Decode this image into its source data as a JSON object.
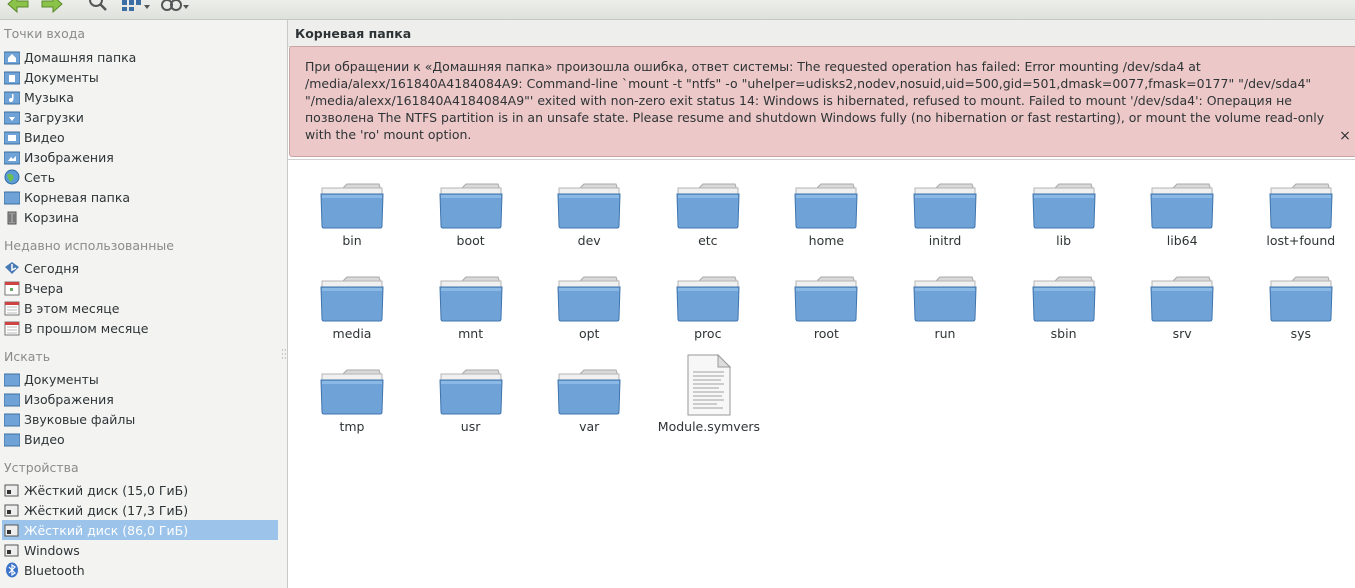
{
  "sidebar": {
    "sections": [
      {
        "title": "Точки входа",
        "items": [
          {
            "label": "Домашняя папка",
            "icon": "home-folder-icon"
          },
          {
            "label": "Документы",
            "icon": "documents-folder-icon"
          },
          {
            "label": "Музыка",
            "icon": "music-folder-icon"
          },
          {
            "label": "Загрузки",
            "icon": "downloads-folder-icon"
          },
          {
            "label": "Видео",
            "icon": "videos-folder-icon"
          },
          {
            "label": "Изображения",
            "icon": "pictures-folder-icon"
          },
          {
            "label": "Сеть",
            "icon": "network-globe-icon"
          },
          {
            "label": "Корневая папка",
            "icon": "root-folder-icon"
          },
          {
            "label": "Корзина",
            "icon": "trash-icon"
          }
        ]
      },
      {
        "title": "Недавно использованные",
        "items": [
          {
            "label": "Сегодня",
            "icon": "recent-today-icon"
          },
          {
            "label": "Вчера",
            "icon": "calendar-icon"
          },
          {
            "label": "В этом месяце",
            "icon": "calendar-icon"
          },
          {
            "label": "В прошлом месяце",
            "icon": "calendar-icon"
          }
        ]
      },
      {
        "title": "Искать",
        "items": [
          {
            "label": "Документы",
            "icon": "documents-folder-icon"
          },
          {
            "label": "Изображения",
            "icon": "pictures-folder-icon"
          },
          {
            "label": "Звуковые файлы",
            "icon": "music-folder-icon"
          },
          {
            "label": "Видео",
            "icon": "videos-folder-icon"
          }
        ]
      },
      {
        "title": "Устройства",
        "items": [
          {
            "label": "Жёсткий диск (15,0 ГиБ)",
            "icon": "hard-disk-icon"
          },
          {
            "label": "Жёсткий диск (17,3 ГиБ)",
            "icon": "hard-disk-icon"
          },
          {
            "label": "Жёсткий диск (86,0 ГиБ)",
            "icon": "hard-disk-icon",
            "selected": true
          },
          {
            "label": "Windows",
            "icon": "hard-disk-icon"
          },
          {
            "label": "Bluetooth",
            "icon": "bluetooth-icon"
          }
        ]
      }
    ]
  },
  "location": {
    "title": "Корневая папка"
  },
  "error": {
    "message": "При обращении к «Домашняя папка» произошла ошибка, ответ системы: The requested operation has failed: Error mounting /dev/sda4 at /media/alexx/161840A4184084A9: Command-line `mount -t \"ntfs\" -o \"uhelper=udisks2,nodev,nosuid,uid=500,gid=501,dmask=0077,fmask=0177\" \"/dev/sda4\" \"/media/alexx/161840A4184084A9\"' exited with non-zero exit status 14: Windows is hibernated, refused to mount. Failed to mount '/dev/sda4': Операция не позволена The NTFS partition is in an unsafe state. Please resume and shutdown Windows fully (no hibernation or fast restarting), or mount the volume read-only with the 'ro' mount option.",
    "close_glyph": "×"
  },
  "files": [
    {
      "name": "bin",
      "type": "folder"
    },
    {
      "name": "boot",
      "type": "folder"
    },
    {
      "name": "dev",
      "type": "folder"
    },
    {
      "name": "etc",
      "type": "folder"
    },
    {
      "name": "home",
      "type": "folder"
    },
    {
      "name": "initrd",
      "type": "folder"
    },
    {
      "name": "lib",
      "type": "folder"
    },
    {
      "name": "lib64",
      "type": "folder"
    },
    {
      "name": "lost+found",
      "type": "folder"
    },
    {
      "name": "media",
      "type": "folder"
    },
    {
      "name": "mnt",
      "type": "folder"
    },
    {
      "name": "opt",
      "type": "folder"
    },
    {
      "name": "proc",
      "type": "folder"
    },
    {
      "name": "root",
      "type": "folder"
    },
    {
      "name": "run",
      "type": "folder"
    },
    {
      "name": "sbin",
      "type": "folder"
    },
    {
      "name": "srv",
      "type": "folder"
    },
    {
      "name": "sys",
      "type": "folder"
    },
    {
      "name": "tmp",
      "type": "folder"
    },
    {
      "name": "usr",
      "type": "folder"
    },
    {
      "name": "var",
      "type": "folder"
    },
    {
      "name": "Module.symvers",
      "type": "file"
    }
  ],
  "colors": {
    "folder": "#6fa3d8",
    "selection": "#9cc4ea",
    "error_bg": "#edc8c8"
  }
}
